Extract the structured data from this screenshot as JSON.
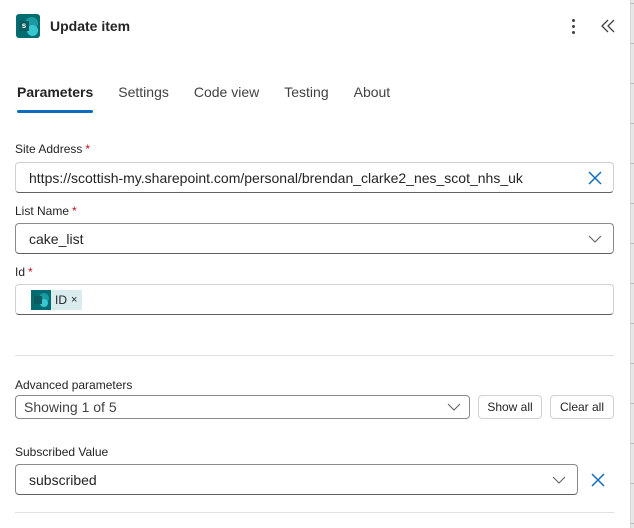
{
  "header": {
    "title": "Update item",
    "app_icon": "sharepoint-icon",
    "more_icon": "more-vertical-icon",
    "collapse_icon": "double-chevron-left-icon"
  },
  "tabs": [
    {
      "label": "Parameters",
      "active": true
    },
    {
      "label": "Settings",
      "active": false
    },
    {
      "label": "Code view",
      "active": false
    },
    {
      "label": "Testing",
      "active": false
    },
    {
      "label": "About",
      "active": false
    }
  ],
  "fields": {
    "site_address": {
      "label": "Site Address",
      "required_marker": "*",
      "value": "https://scottish-my.sharepoint.com/personal/brendan_clarke2_nes_scot_nhs_uk"
    },
    "list_name": {
      "label": "List Name",
      "required_marker": "*",
      "value": "cake_list"
    },
    "id": {
      "label": "Id",
      "required_marker": "*",
      "token_label": "ID",
      "token_remove": "×"
    }
  },
  "advanced": {
    "label": "Advanced parameters",
    "value": "Showing 1 of 5",
    "show_all_label": "Show all",
    "clear_all_label": "Clear all"
  },
  "subscribed": {
    "label": "Subscribed Value",
    "value": "subscribed"
  },
  "colors": {
    "accent": "#0f6cbd",
    "required": "#c50f1f",
    "sharepoint": "#036c70",
    "token_bg": "#d9ebec"
  }
}
